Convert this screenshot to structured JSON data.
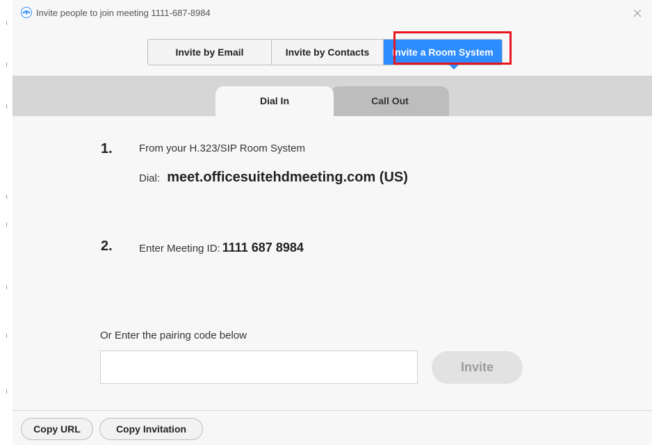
{
  "window": {
    "title": "Invite people to join meeting 1111-687-8984",
    "close_icon": "close-icon"
  },
  "invite_tabs": {
    "email": "Invite by Email",
    "contacts": "Invite by Contacts",
    "room_system": "Invite a Room System",
    "selected": "Invite a Room System"
  },
  "dial_tabs": {
    "dial_in": "Dial In",
    "call_out": "Call Out",
    "selected": "Dial In"
  },
  "steps": [
    {
      "number": "1.",
      "line1": "From your H.323/SIP Room System",
      "dial_label": "Dial:",
      "dial_address": "meet.officesuitehdmeeting.com (US)"
    },
    {
      "number": "2.",
      "label": "Enter Meeting ID:",
      "meeting_id": "1111 687 8984"
    }
  ],
  "pairing": {
    "label": "Or Enter the pairing code below",
    "value": "",
    "placeholder": "",
    "invite_label": "Invite"
  },
  "footer": {
    "copy_url": "Copy URL",
    "copy_invitation": "Copy Invitation"
  },
  "colors": {
    "accent": "#2d8cff",
    "highlight": "#e8141f",
    "band": "#d6d6d6",
    "background": "#f7f7f7"
  }
}
